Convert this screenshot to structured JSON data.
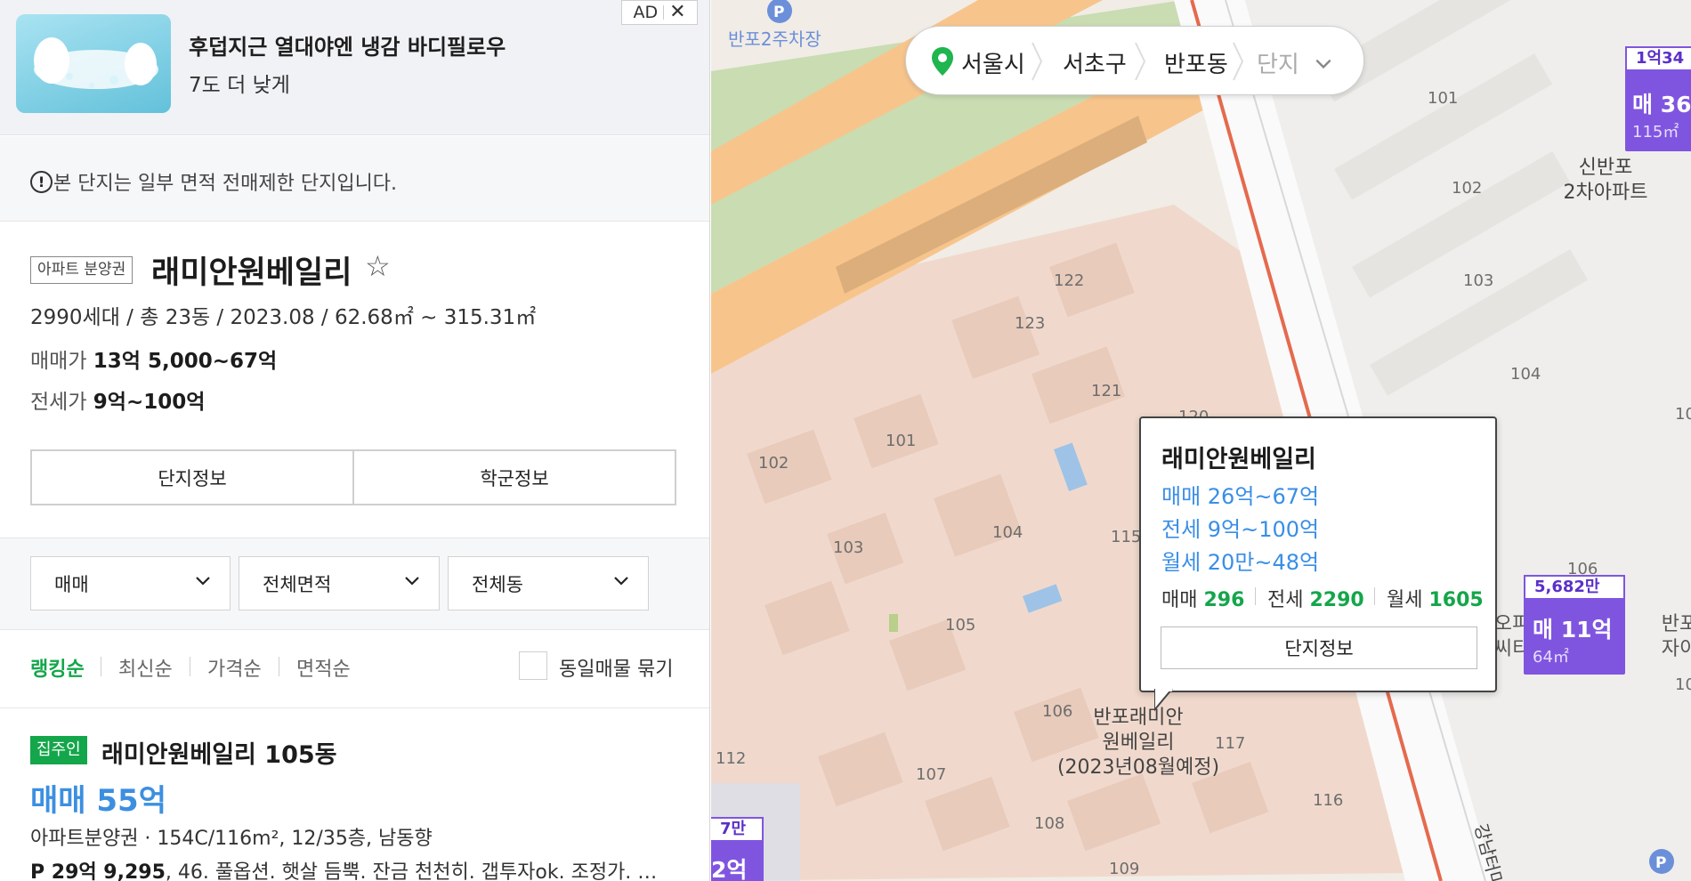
{
  "ad": {
    "title": "후덥지근 열대야엔 냉감 바디필로우",
    "subtitle": "7도 더 낮게",
    "badge": "AD",
    "close": "✕",
    "image_icon": "pillow-product-image"
  },
  "notice": {
    "icon": "!",
    "text": "본 단지는 일부 면적 전매제한 단지입니다."
  },
  "complex": {
    "type_badge": "아파트 분양권",
    "name": "래미안원베일리",
    "favorite_icon": "☆",
    "summary": "2990세대 / 총 23동 / 2023.08 / 62.68㎡ ~ 315.31㎡",
    "sale_label": "매매가",
    "sale_value": "13억 5,000~67억",
    "jeonse_label": "전세가",
    "jeonse_value": "9억~100억",
    "buttons": [
      "단지정보",
      "학군정보"
    ]
  },
  "filters": {
    "trade": "매매",
    "area": "전체면적",
    "dong": "전체동"
  },
  "sort": {
    "options": [
      "랭킹순",
      "최신순",
      "가격순",
      "면적순"
    ],
    "active": "랭킹순",
    "group_label": "동일매물 묶기"
  },
  "listing": {
    "badge": "집주인",
    "title": "래미안원베일리 105동",
    "price": "매매 55억",
    "desc": "아파트분양권 · 154C/116m², 12/35층, 남동향",
    "memo_bold": "P 29억 9,295",
    "memo": ", 46. 풀옵션. 햇살 듬뿍. 잔금 천천히. 갭투자ok. 조정가. …"
  },
  "breadcrumb": {
    "city": "서울시",
    "district": "서초구",
    "dong": "반포동",
    "complex_placeholder": "단지"
  },
  "popup": {
    "title": "래미안원베일리",
    "sale": "매매 26억~67억",
    "jeonse": "전세 9억~100억",
    "monthly": "월세 20만~48억",
    "sale_count_label": "매매",
    "sale_count": "296",
    "jeonse_count_label": "전세",
    "jeonse_count": "2290",
    "monthly_count_label": "월세",
    "monthly_count": "1605",
    "button": "단지정보"
  },
  "map": {
    "parking_label": "반포2주차장",
    "complex_label": "반포래미안\n원베일리\n(2023년08월예정)",
    "buildings": [
      "122",
      "123",
      "121",
      "120",
      "101",
      "102",
      "104",
      "103",
      "115",
      "105",
      "106",
      "117",
      "107",
      "116",
      "108",
      "109",
      "112"
    ],
    "right_buildings": [
      "101",
      "102",
      "103",
      "104",
      "10",
      "106",
      "10"
    ],
    "shinbanpo_label": "신반포\n2차아파트",
    "office_label": "오피\n씨티",
    "right_edge_label": "반포\n자이",
    "road_label": "강남터미널"
  },
  "markers": [
    {
      "top": "1억34",
      "main": "매 36",
      "sub": "115㎡"
    },
    {
      "top": "5,682만",
      "main": "매 11억",
      "sub": "64㎡"
    },
    {
      "top": "7만",
      "main": "2억",
      "sub": ""
    }
  ],
  "colors": {
    "accent_green": "#14a64a",
    "link_blue": "#3a8ee6",
    "marker_purple": "#7f55e0",
    "road_orange": "#f7c58c",
    "park_green": "#c9dcb2"
  }
}
